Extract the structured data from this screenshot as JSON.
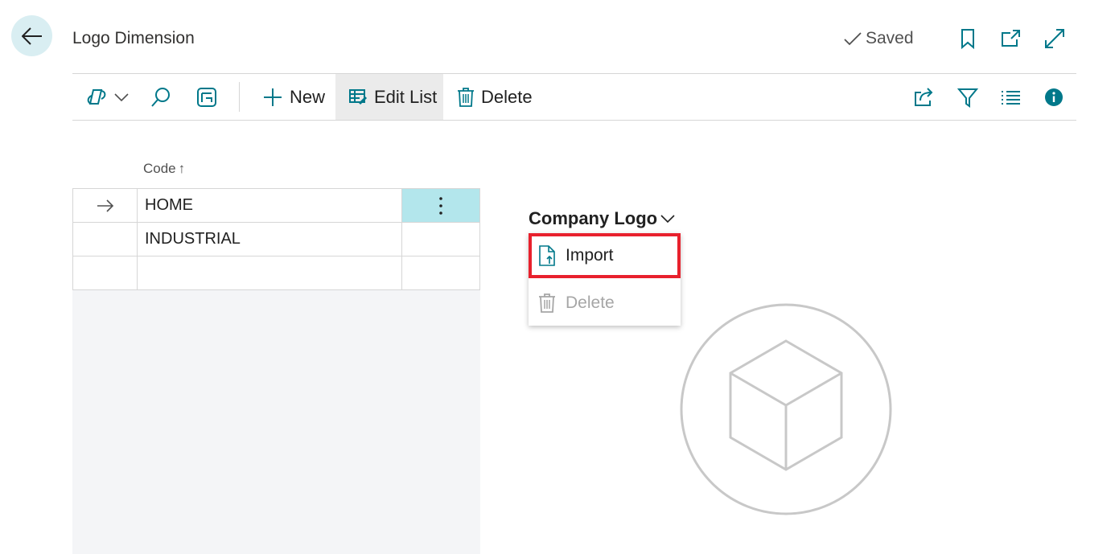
{
  "header": {
    "title": "Logo Dimension",
    "saved_label": "Saved"
  },
  "action_bar": {
    "new_label": "New",
    "edit_list_label": "Edit List",
    "delete_label": "Delete"
  },
  "list": {
    "column_header": "Code",
    "sort_indicator": "↑",
    "rows": [
      {
        "code": "HOME",
        "selected": true
      },
      {
        "code": "INDUSTRIAL",
        "selected": false
      },
      {
        "code": "",
        "selected": false
      }
    ]
  },
  "factbox": {
    "title": "Company Logo",
    "menu": {
      "import_label": "Import",
      "delete_label": "Delete"
    }
  },
  "colors": {
    "accent": "#00788a",
    "selected_cell": "#b3e6ec",
    "highlight_border": "#e8212d",
    "back_button_bg": "#d9eef2"
  }
}
